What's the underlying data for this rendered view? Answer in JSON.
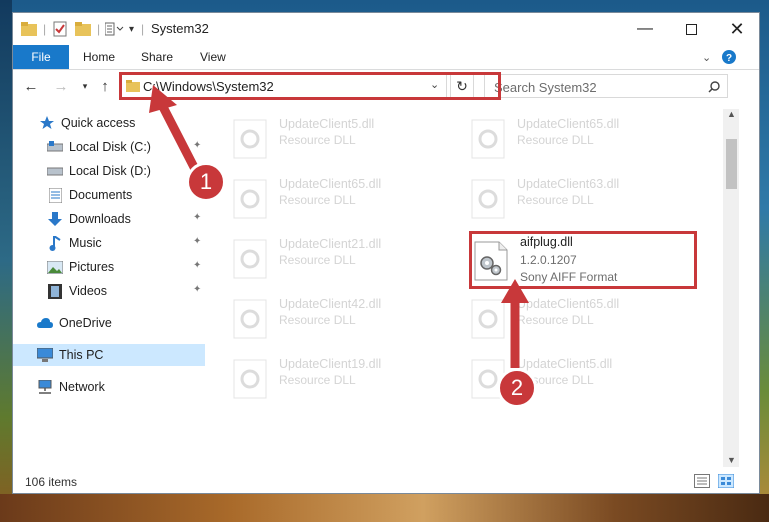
{
  "window": {
    "title": "System32"
  },
  "ribbon": {
    "file": "File",
    "home": "Home",
    "share": "Share",
    "view": "View"
  },
  "address": {
    "path": "C:\\Windows\\System32",
    "search_placeholder": "Search System32"
  },
  "nav": {
    "quick_access": "Quick access",
    "items": [
      {
        "label": "Local Disk (C:)"
      },
      {
        "label": "Local Disk (D:)"
      },
      {
        "label": "Documents"
      },
      {
        "label": "Downloads"
      },
      {
        "label": "Music"
      },
      {
        "label": "Pictures"
      },
      {
        "label": "Videos"
      }
    ],
    "onedrive": "OneDrive",
    "thispc": "This PC",
    "network": "Network"
  },
  "files": {
    "col1": [
      {
        "name": "UpdateClient5.dll",
        "sub": "Resource DLL"
      },
      {
        "name": "UpdateClient65.dll",
        "sub": "Resource DLL"
      },
      {
        "name": "UpdateClient21.dll",
        "sub": "Resource DLL"
      },
      {
        "name": "UpdateClient42.dll",
        "sub": "Resource DLL"
      },
      {
        "name": "UpdateClient19.dll",
        "sub": "Resource DLL"
      }
    ],
    "col2": [
      {
        "name": "UpdateClient65.dll",
        "sub": "Resource DLL"
      },
      {
        "name": "UpdateClient63.dll",
        "sub": "Resource DLL"
      },
      {
        "name": "aifplug.dll",
        "sub": "1.2.0.1207",
        "sub2": "Sony AIFF Format"
      },
      {
        "name": "UpdateClient65.dll",
        "sub": "Resource DLL"
      },
      {
        "name": "UpdateClient5.dll",
        "sub": "Resource DLL"
      }
    ]
  },
  "status": {
    "items": "106 items"
  },
  "annotations": {
    "step1": "1",
    "step2": "2"
  },
  "colors": {
    "accent": "#1979ca",
    "highlight": "#c8383a"
  }
}
